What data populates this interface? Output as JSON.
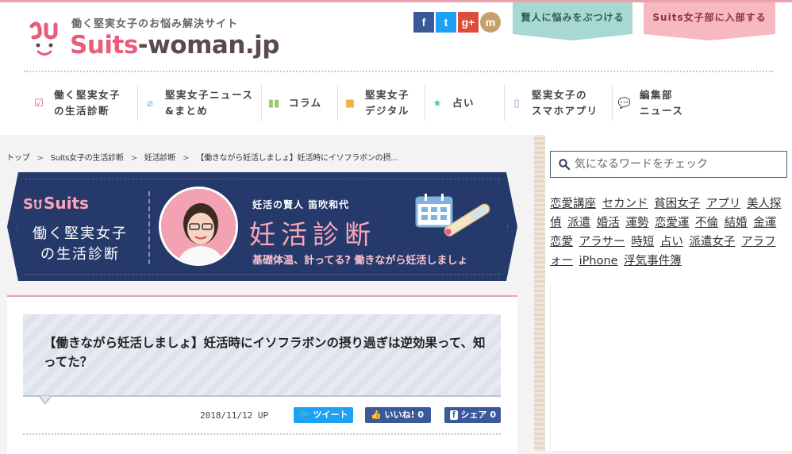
{
  "header": {
    "tagline": "働く堅実女子のお悩み解決サイト",
    "logo_part1": "Suits",
    "logo_part2": "-woman.jp",
    "social": {
      "facebook": "f",
      "twitter": "t",
      "googleplus": "g+",
      "mixi": "m"
    },
    "btn_consult": "賢人に悩みをぶつける",
    "btn_join": "Suits女子部に入部する"
  },
  "nav": [
    {
      "label": "働く堅実女子\nの生活診断",
      "icon": "checklist-icon",
      "color": "#e85e7d"
    },
    {
      "label": "堅実女子ニュース\n&まとめ",
      "icon": "paperclip-icon",
      "color": "#7db7e6"
    },
    {
      "label": "コラム",
      "icon": "book-icon",
      "color": "#9ac969"
    },
    {
      "label": "堅実女子\nデジタル",
      "icon": "bag-icon",
      "color": "#f2b24a"
    },
    {
      "label": "占い",
      "icon": "star-icon",
      "color": "#5fc5b6"
    },
    {
      "label": "堅実女子の\nスマホアプリ",
      "icon": "smartphone-icon",
      "color": "#c08ad6"
    },
    {
      "label": "編集部\nニュース",
      "icon": "speech-bubble-icon",
      "color": "#e85e7d"
    }
  ],
  "breadcrumb": {
    "items": [
      "トップ",
      "Suits女子の生活診断",
      "妊活診断",
      "【働きながら妊活しましょ】妊活時にイソフラボンの摂..."
    ],
    "separator": ">"
  },
  "banner": {
    "suits_label": "Suits",
    "line1": "働く堅実女子",
    "line2": "の生活診断",
    "subtitle": "妊活の賢人 笛吹和代",
    "title": "妊活診断",
    "tagline": "基礎体温、計ってる? 働きながら妊活しましょ"
  },
  "article": {
    "title": "【働きながら妊活しましょ】妊活時にイソフラボンの摂り過ぎは逆効果って、知ってた？",
    "date": "2018/11/12 UP",
    "tweet": "ツイート",
    "like": "いいね! 0",
    "share": "シェア 0"
  },
  "sidebar": {
    "search_placeholder": "気になるワードをチェック",
    "tags": [
      "恋愛講座",
      "セカンド",
      "貧困女子",
      "アプリ",
      "美人探偵",
      "派遣",
      "婚活",
      "運勢",
      "恋愛運",
      "不倫",
      "結婚",
      "金運",
      "恋愛",
      "アラサー",
      "時短",
      "占い",
      "派遣女子",
      "アラフォー",
      "iPhone",
      "浮気事件簿"
    ]
  },
  "colors": {
    "brand_pink": "#e85e7d",
    "banner_navy": "#25396b",
    "teal_button": "#a8d8d2",
    "pink_button": "#f8b8c0"
  }
}
